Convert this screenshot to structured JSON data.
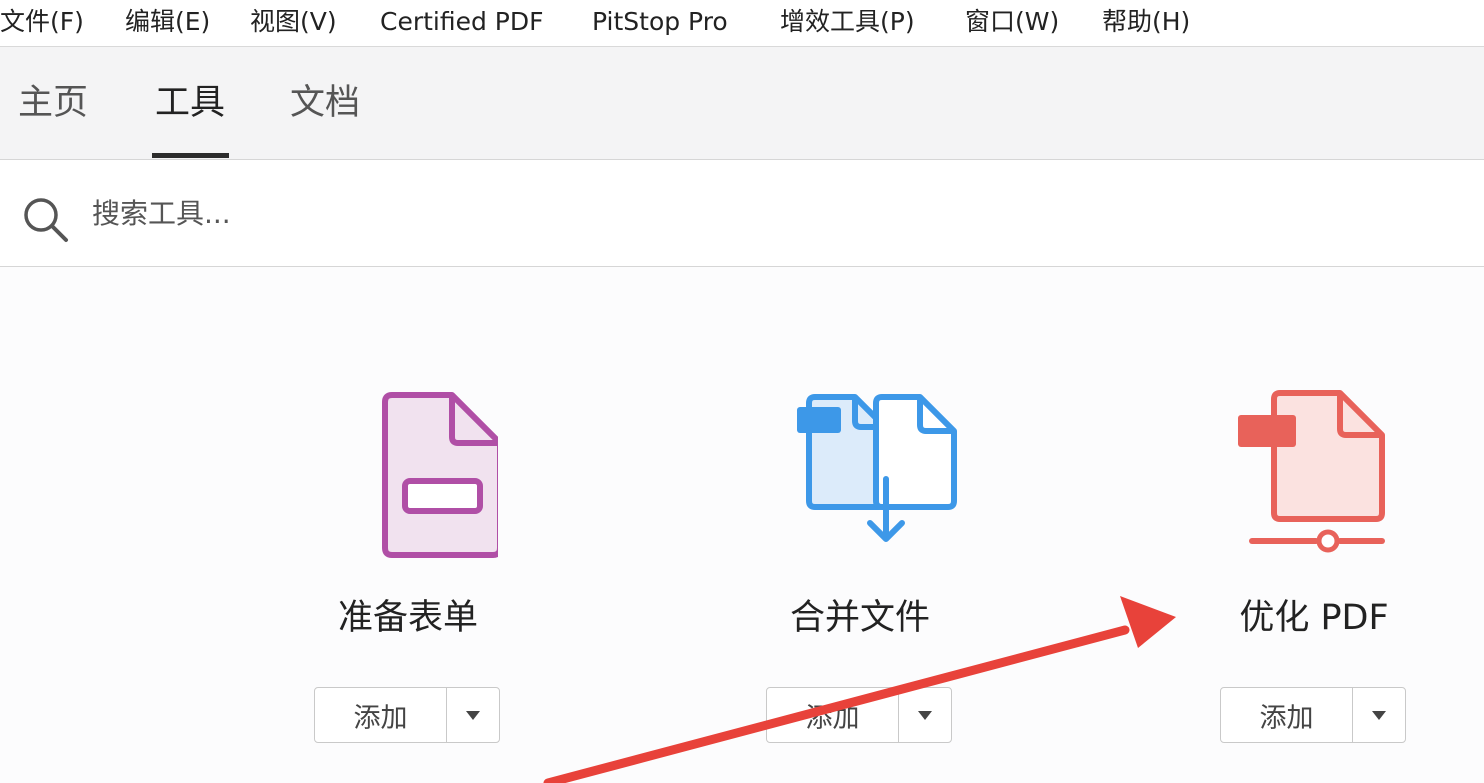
{
  "menu": {
    "items": [
      "文件(F)",
      "编辑(E)",
      "视图(V)",
      "Certified PDF",
      "PitStop Pro",
      "增效工具(P)",
      "窗口(W)",
      "帮助(H)"
    ]
  },
  "tabs": {
    "items": [
      "主页",
      "工具",
      "文档"
    ],
    "active": "工具"
  },
  "search": {
    "placeholder": "搜索工具..."
  },
  "tools": [
    {
      "name": "准备表单",
      "add_label": "添加",
      "icon": "prepare-form-icon",
      "color": "#b04fa6"
    },
    {
      "name": "合并文件",
      "add_label": "添加",
      "icon": "combine-files-icon",
      "color": "#3d98e8"
    },
    {
      "name": "优化 PDF",
      "add_label": "添加",
      "icon": "optimize-pdf-icon",
      "color": "#e8625a"
    }
  ],
  "annotation": {
    "icon": "red-arrow-annotation",
    "color": "#e8423a"
  }
}
